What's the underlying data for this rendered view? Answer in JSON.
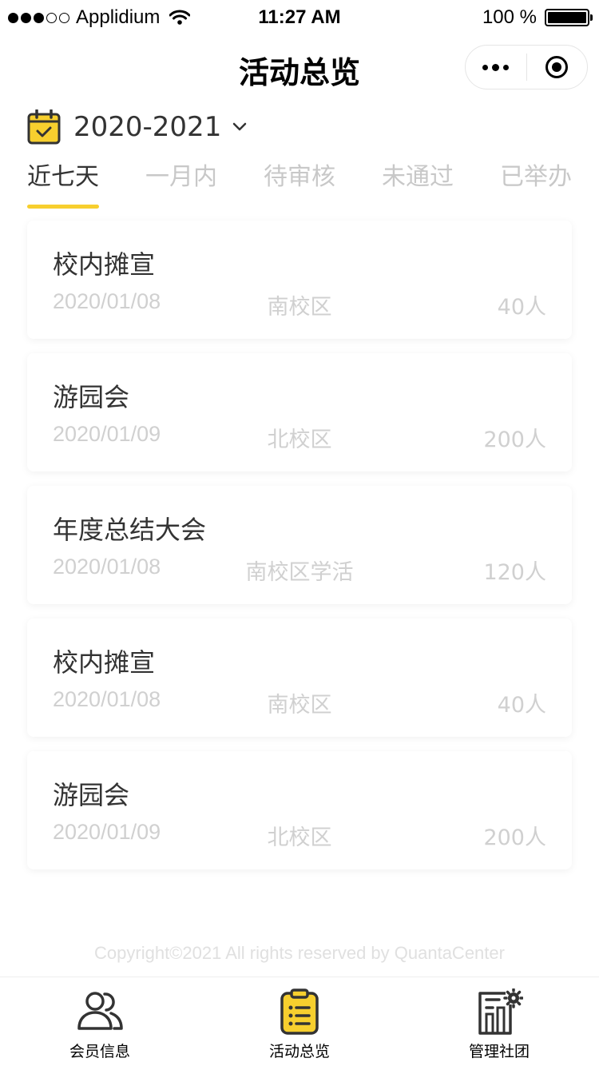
{
  "status_bar": {
    "carrier": "Applidium",
    "time": "11:27 AM",
    "battery": "100 %"
  },
  "nav": {
    "title": "活动总览"
  },
  "year_selector": {
    "value": "2020-2021"
  },
  "tabs": [
    {
      "label": "近七天",
      "active": true
    },
    {
      "label": "一月内",
      "active": false
    },
    {
      "label": "待审核",
      "active": false
    },
    {
      "label": "未通过",
      "active": false
    },
    {
      "label": "已举办",
      "active": false
    }
  ],
  "activities": [
    {
      "title": "校内摊宣",
      "date": "2020/01/08",
      "place": "南校区",
      "count": "40人"
    },
    {
      "title": "游园会",
      "date": "2020/01/09",
      "place": "北校区",
      "count": "200人"
    },
    {
      "title": "年度总结大会",
      "date": "2020/01/08",
      "place": "南校区学活",
      "count": "120人"
    },
    {
      "title": "校内摊宣",
      "date": "2020/01/08",
      "place": "南校区",
      "count": "40人"
    },
    {
      "title": "游园会",
      "date": "2020/01/09",
      "place": "北校区",
      "count": "200人"
    }
  ],
  "copyright": "Copyright©2021 All rights reserved by QuantaCenter",
  "tab_bar": [
    {
      "label": "会员信息",
      "icon": "members-icon",
      "active": false
    },
    {
      "label": "活动总览",
      "icon": "clipboard-list-icon",
      "active": true
    },
    {
      "label": "管理社团",
      "icon": "building-gear-icon",
      "active": false
    }
  ],
  "colors": {
    "accent": "#f7cf2e",
    "text": "#333333",
    "muted": "#d0d0d0"
  }
}
